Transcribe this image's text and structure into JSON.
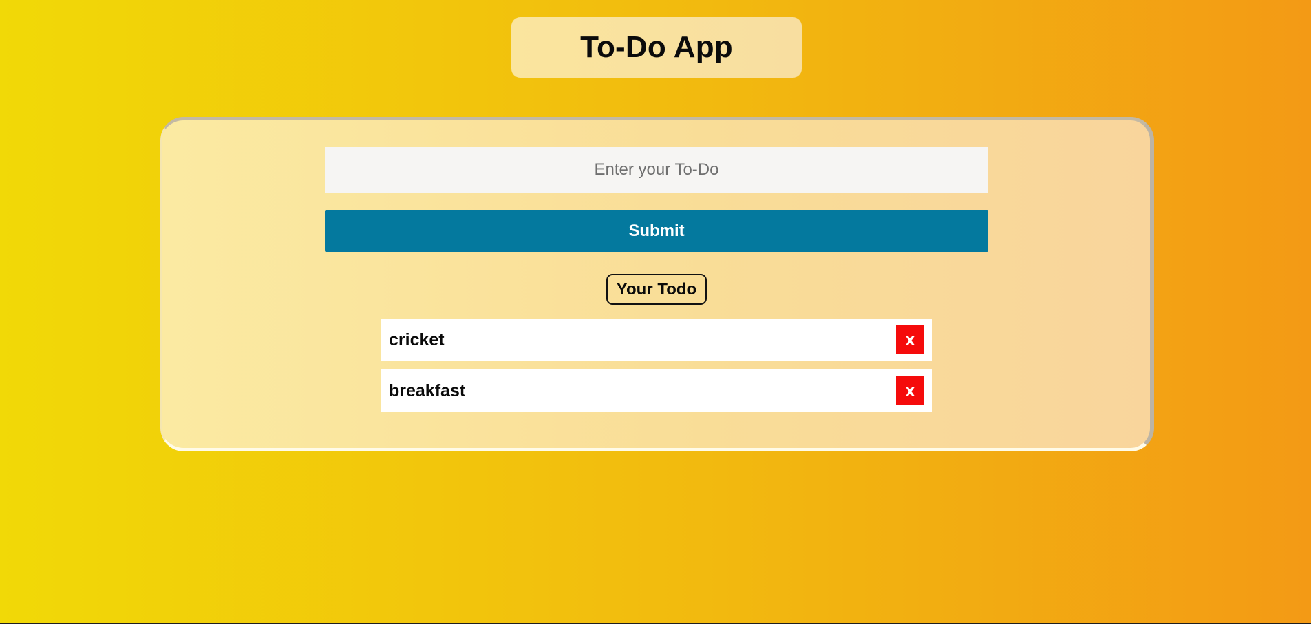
{
  "app": {
    "title": "To-Do App"
  },
  "form": {
    "input_value": "",
    "input_placeholder": "Enter your To-Do",
    "submit_label": "Submit"
  },
  "list": {
    "heading": "Your Todo",
    "items": [
      {
        "text": "cricket",
        "delete_label": "x",
        "delete_icon": "close-icon"
      },
      {
        "text": "breakfast",
        "delete_label": "x",
        "delete_icon": "close-icon"
      }
    ]
  },
  "colors": {
    "background_gradient_start": "#f1d907",
    "background_gradient_end": "#f39a15",
    "panel": "#fae59e",
    "submit_button": "#04799e",
    "delete_button": "#f50b0b",
    "input_background": "#f6f5f3",
    "list_item_background": "#ffffff"
  }
}
